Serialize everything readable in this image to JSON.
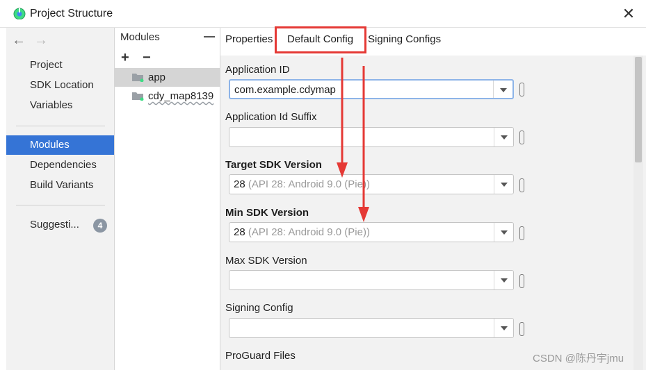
{
  "window": {
    "title": "Project Structure",
    "close_icon": "close-icon",
    "app_icon": "android-studio-icon"
  },
  "nav": {
    "back_icon": "arrow-left-icon",
    "forward_icon": "arrow-right-icon",
    "items_top": [
      {
        "label": "Project"
      },
      {
        "label": "SDK Location"
      },
      {
        "label": "Variables"
      }
    ],
    "items_middle": [
      {
        "label": "Modules",
        "selected": true
      },
      {
        "label": "Dependencies"
      },
      {
        "label": "Build Variants"
      }
    ],
    "suggestions": {
      "label": "Suggesti...",
      "count": "4"
    },
    "selected_color": "#3574d6"
  },
  "modules": {
    "header": "Modules",
    "add_label": "+",
    "remove_label": "−",
    "items": [
      {
        "name": "app",
        "selected": true
      },
      {
        "name": "cdy_map8139"
      }
    ]
  },
  "tabs": [
    {
      "label": "Properties"
    },
    {
      "label": "Default Config",
      "active": true
    },
    {
      "label": "Signing Configs"
    }
  ],
  "highlight_color": "#e53935",
  "form": {
    "fields": [
      {
        "label": "Application ID",
        "value": "com.example.cdymap",
        "hint": "",
        "bold": false
      },
      {
        "label": "Application Id Suffix",
        "value": "",
        "hint": "",
        "bold": false
      },
      {
        "label": "Target SDK Version",
        "value": "28",
        "hint": "(API 28: Android 9.0 (Pie))",
        "bold": true
      },
      {
        "label": "Min SDK Version",
        "value": "28",
        "hint": "(API 28: Android 9.0 (Pie))",
        "bold": true
      },
      {
        "label": "Max SDK Version",
        "value": "",
        "hint": "",
        "bold": false
      },
      {
        "label": "Signing Config",
        "value": "",
        "hint": "",
        "bold": false
      },
      {
        "label": "ProGuard Files",
        "value": "",
        "hint": "",
        "bold": false
      }
    ]
  },
  "watermark": "CSDN @陈丹宇jmu"
}
